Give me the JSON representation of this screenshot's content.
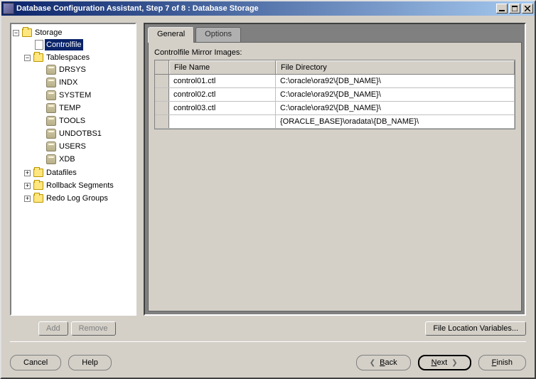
{
  "window": {
    "title": "Database Configuration Assistant, Step 7 of 8 : Database Storage"
  },
  "tree": {
    "root": "Storage",
    "controlfile": "Controlfile",
    "tablespaces": "Tablespaces",
    "ts_items": [
      "DRSYS",
      "INDX",
      "SYSTEM",
      "TEMP",
      "TOOLS",
      "UNDOTBS1",
      "USERS",
      "XDB"
    ],
    "datafiles": "Datafiles",
    "rollback": "Rollback Segments",
    "redo": "Redo Log Groups"
  },
  "tabs": {
    "general": "General",
    "options": "Options"
  },
  "section": {
    "mirror_label": "Controlfile Mirror Images:"
  },
  "grid": {
    "col_name": "File Name",
    "col_dir": "File Directory",
    "rows": [
      {
        "name": "control01.ctl",
        "dir": "C:\\oracle\\ora92\\{DB_NAME}\\"
      },
      {
        "name": "control02.ctl",
        "dir": "C:\\oracle\\ora92\\{DB_NAME}\\"
      },
      {
        "name": "control03.ctl",
        "dir": "C:\\oracle\\ora92\\{DB_NAME}\\"
      },
      {
        "name": "",
        "dir": "{ORACLE_BASE}\\oradata\\{DB_NAME}\\"
      }
    ]
  },
  "buttons": {
    "add": "Add",
    "remove": "Remove",
    "file_loc": "File Location Variables...",
    "cancel": "Cancel",
    "help": "Help",
    "back": "Back",
    "next": "Next",
    "finish": "Finish"
  }
}
